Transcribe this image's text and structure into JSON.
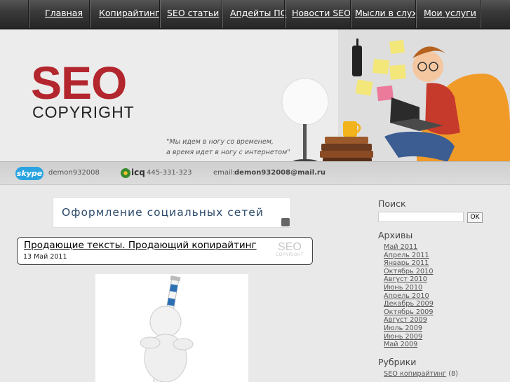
{
  "nav": {
    "items": [
      {
        "label": "Главная"
      },
      {
        "label": "Копирайтинг"
      },
      {
        "label": "SEO статьи"
      },
      {
        "label": "Апдейты ПС"
      },
      {
        "label": "Новости SEO"
      },
      {
        "label": "Мысли в слух"
      },
      {
        "label": "Мои услуги"
      }
    ]
  },
  "header": {
    "logo_top": "SEO",
    "logo_bottom": "COPYRIGHT",
    "tagline_line1": "\"Мы идем в ногу со временем,",
    "tagline_line2": "а время идет в ногу с интернетом\""
  },
  "contacts": {
    "skype_logo": "skype",
    "skype": "demon932008",
    "icq_logo": "icq",
    "icq": "445-331-323",
    "email_label": "email:",
    "email": "demon932008@mail.ru"
  },
  "main": {
    "banner_text": "Оформление социальных сетей",
    "post": {
      "title": "Продающие тексты. Продающий копирайтинг",
      "date": "13 Май 2011",
      "mark_top": "SEO",
      "mark_bottom": "COPYRIGHT"
    }
  },
  "sidebar": {
    "search": {
      "heading": "Поиск",
      "value": "",
      "button": "OK"
    },
    "archives": {
      "heading": "Архивы",
      "items": [
        "Май 2011",
        "Апрель 2011",
        "Январь 2011",
        "Октябрь 2010",
        "Август 2010",
        "Июнь 2010",
        "Апрель 2010",
        "Декабрь 2009",
        "Октябрь 2009",
        "Август 2009",
        "Июль 2009",
        "Июнь 2009",
        "Май 2009"
      ]
    },
    "categories": {
      "heading": "Рубрики",
      "items": [
        {
          "label": "SEO копирайтинг",
          "count": "(8)"
        }
      ]
    }
  },
  "colors": {
    "brand_red": "#b3262d",
    "nav_bg": "#2b2b2b",
    "link": "#555555"
  }
}
